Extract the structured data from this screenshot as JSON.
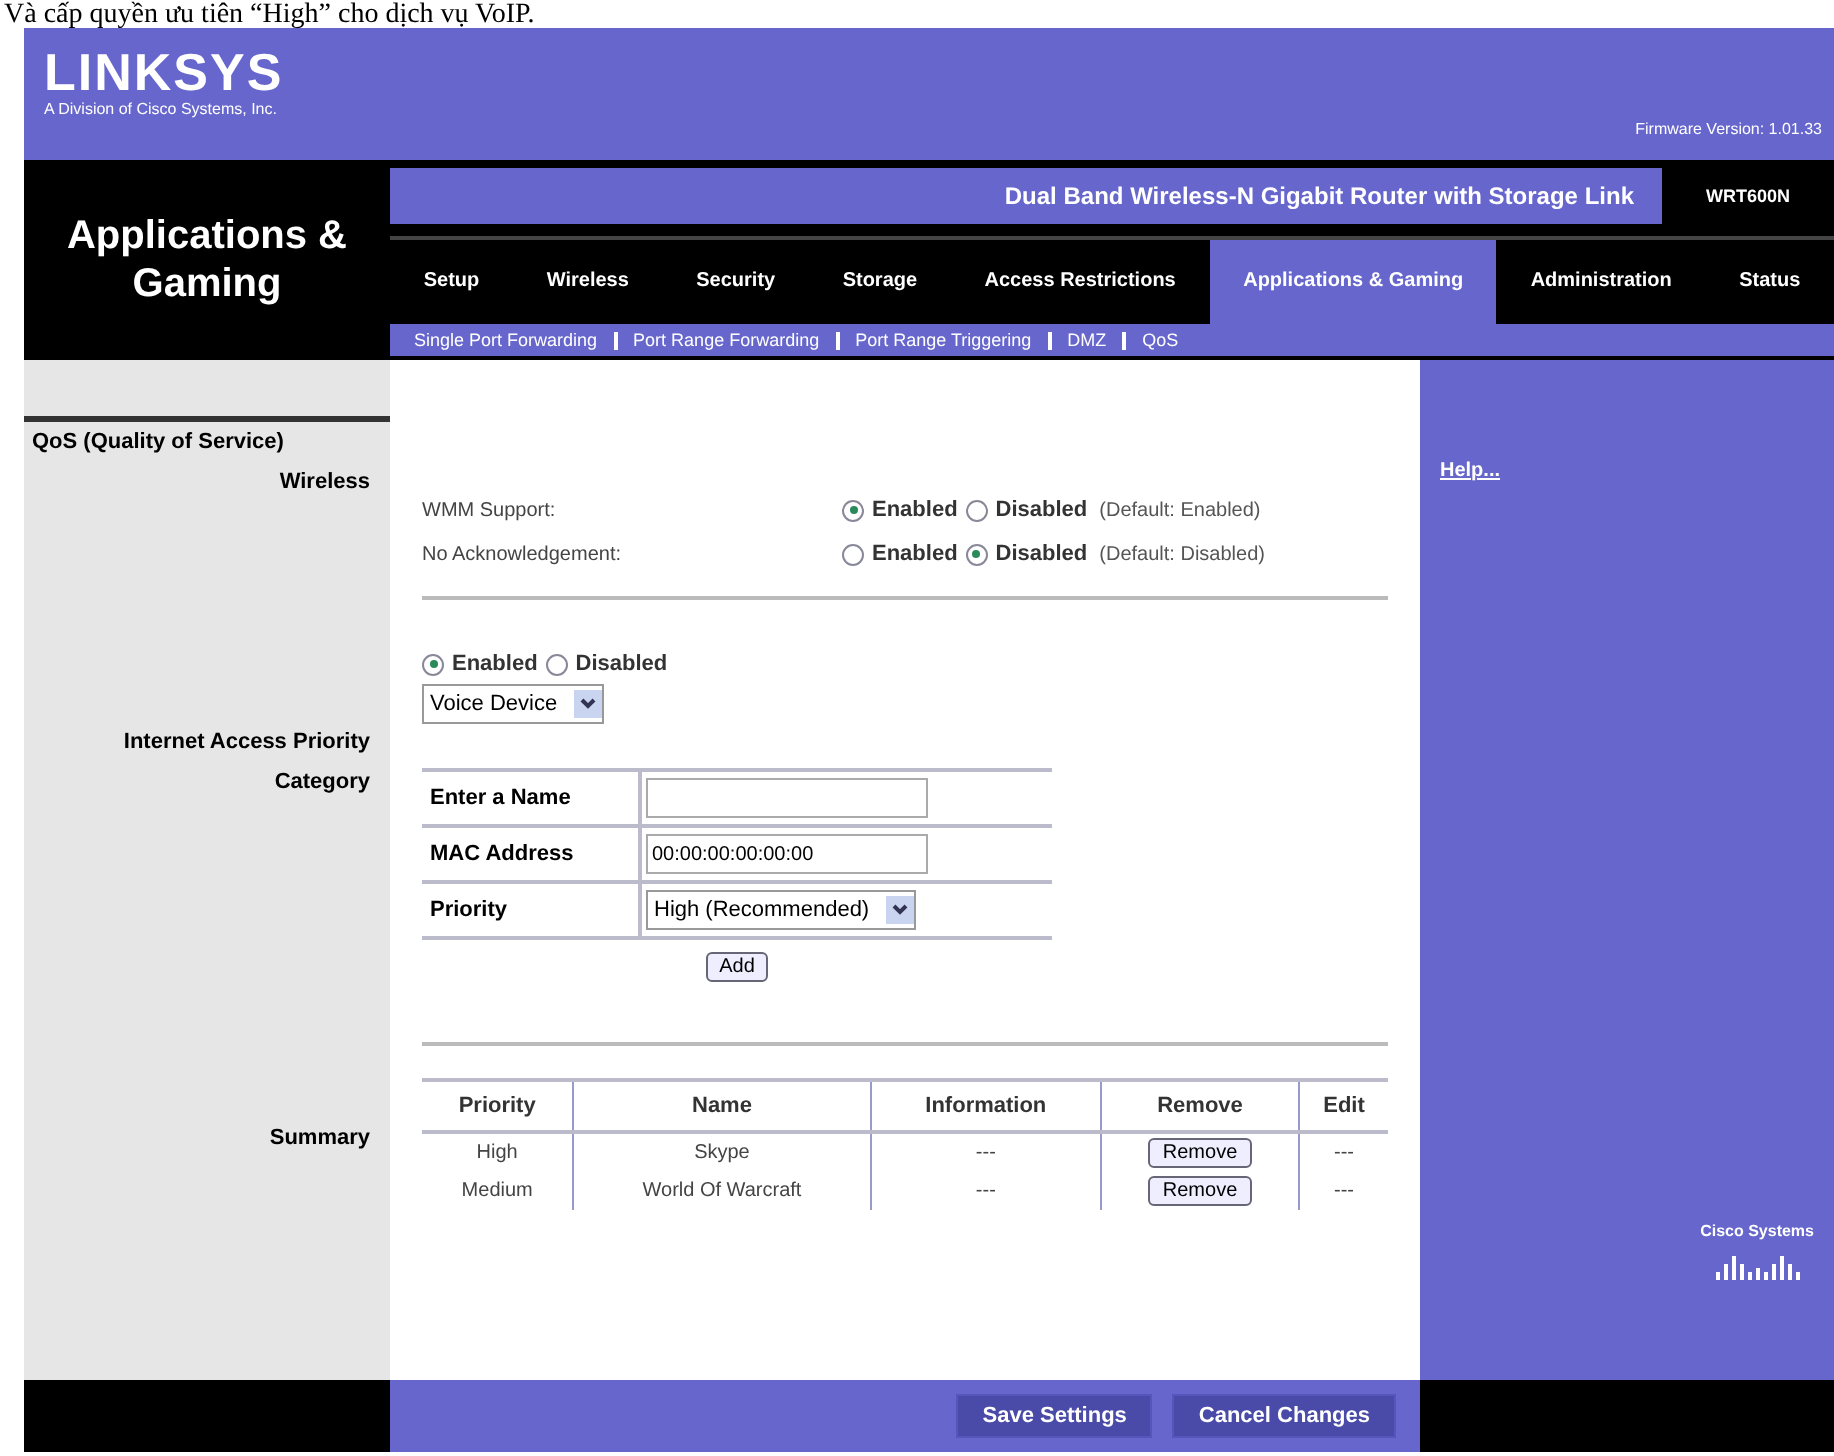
{
  "caption": "Và cấp quyền ưu tiên “High” cho dịch vụ VoIP.",
  "brand": {
    "logo": "LINKSYS",
    "tagline": "A Division of Cisco Systems, Inc.",
    "firmware": "Firmware Version: 1.01.33"
  },
  "section_title": "Applications & Gaming",
  "product_name": "Dual Band Wireless-N Gigabit Router with Storage Link",
  "model": "WRT600N",
  "tabs": [
    {
      "label": "Setup",
      "selected": false
    },
    {
      "label": "Wireless",
      "selected": false
    },
    {
      "label": "Security",
      "selected": false
    },
    {
      "label": "Storage",
      "selected": false
    },
    {
      "label": "Access Restrictions",
      "selected": false
    },
    {
      "label": "Applications & Gaming",
      "selected": true
    },
    {
      "label": "Administration",
      "selected": false
    },
    {
      "label": "Status",
      "selected": false
    }
  ],
  "subtabs": [
    "Single Port Forwarding",
    "Port Range Forwarding",
    "Port Range Triggering",
    "DMZ",
    "QoS"
  ],
  "qos_heading": "QoS (Quality of Service)",
  "wireless": {
    "label": "Wireless",
    "settings": [
      {
        "name": "WMM Support:",
        "options": [
          {
            "label": "Enabled",
            "selected": true
          },
          {
            "label": "Disabled",
            "selected": false
          }
        ],
        "default": "(Default: Enabled)"
      },
      {
        "name": "No Acknowledgement:",
        "options": [
          {
            "label": "Enabled",
            "selected": false
          },
          {
            "label": "Disabled",
            "selected": true
          }
        ],
        "default": "(Default: Disabled)"
      }
    ]
  },
  "internet_access_priority": {
    "label": "Internet Access Priority",
    "options": [
      {
        "label": "Enabled",
        "selected": true
      },
      {
        "label": "Disabled",
        "selected": false
      }
    ]
  },
  "category": {
    "label": "Category",
    "value": "Voice Device"
  },
  "form": [
    {
      "label": "Enter a Name",
      "kind": "text"
    },
    {
      "label": "MAC Address",
      "kind": "text",
      "value": "00:00:00:00:00:00"
    },
    {
      "label": "Priority",
      "kind": "select",
      "value": "High (Recommended)"
    }
  ],
  "add_button": "Add",
  "summary": {
    "label": "Summary",
    "columns": [
      "Priority",
      "Name",
      "Information",
      "Remove",
      "Edit"
    ],
    "rows": [
      {
        "priority": "High",
        "name": "Skype",
        "information": "---",
        "remove": "Remove",
        "edit": "---"
      },
      {
        "priority": "Medium",
        "name": "World Of Warcraft",
        "information": "---",
        "remove": "Remove",
        "edit": "---"
      }
    ]
  },
  "help_link": "Help...",
  "footer_buttons": [
    "Save Settings",
    "Cancel Changes"
  ],
  "cisco_logo": "Cisco Systems"
}
